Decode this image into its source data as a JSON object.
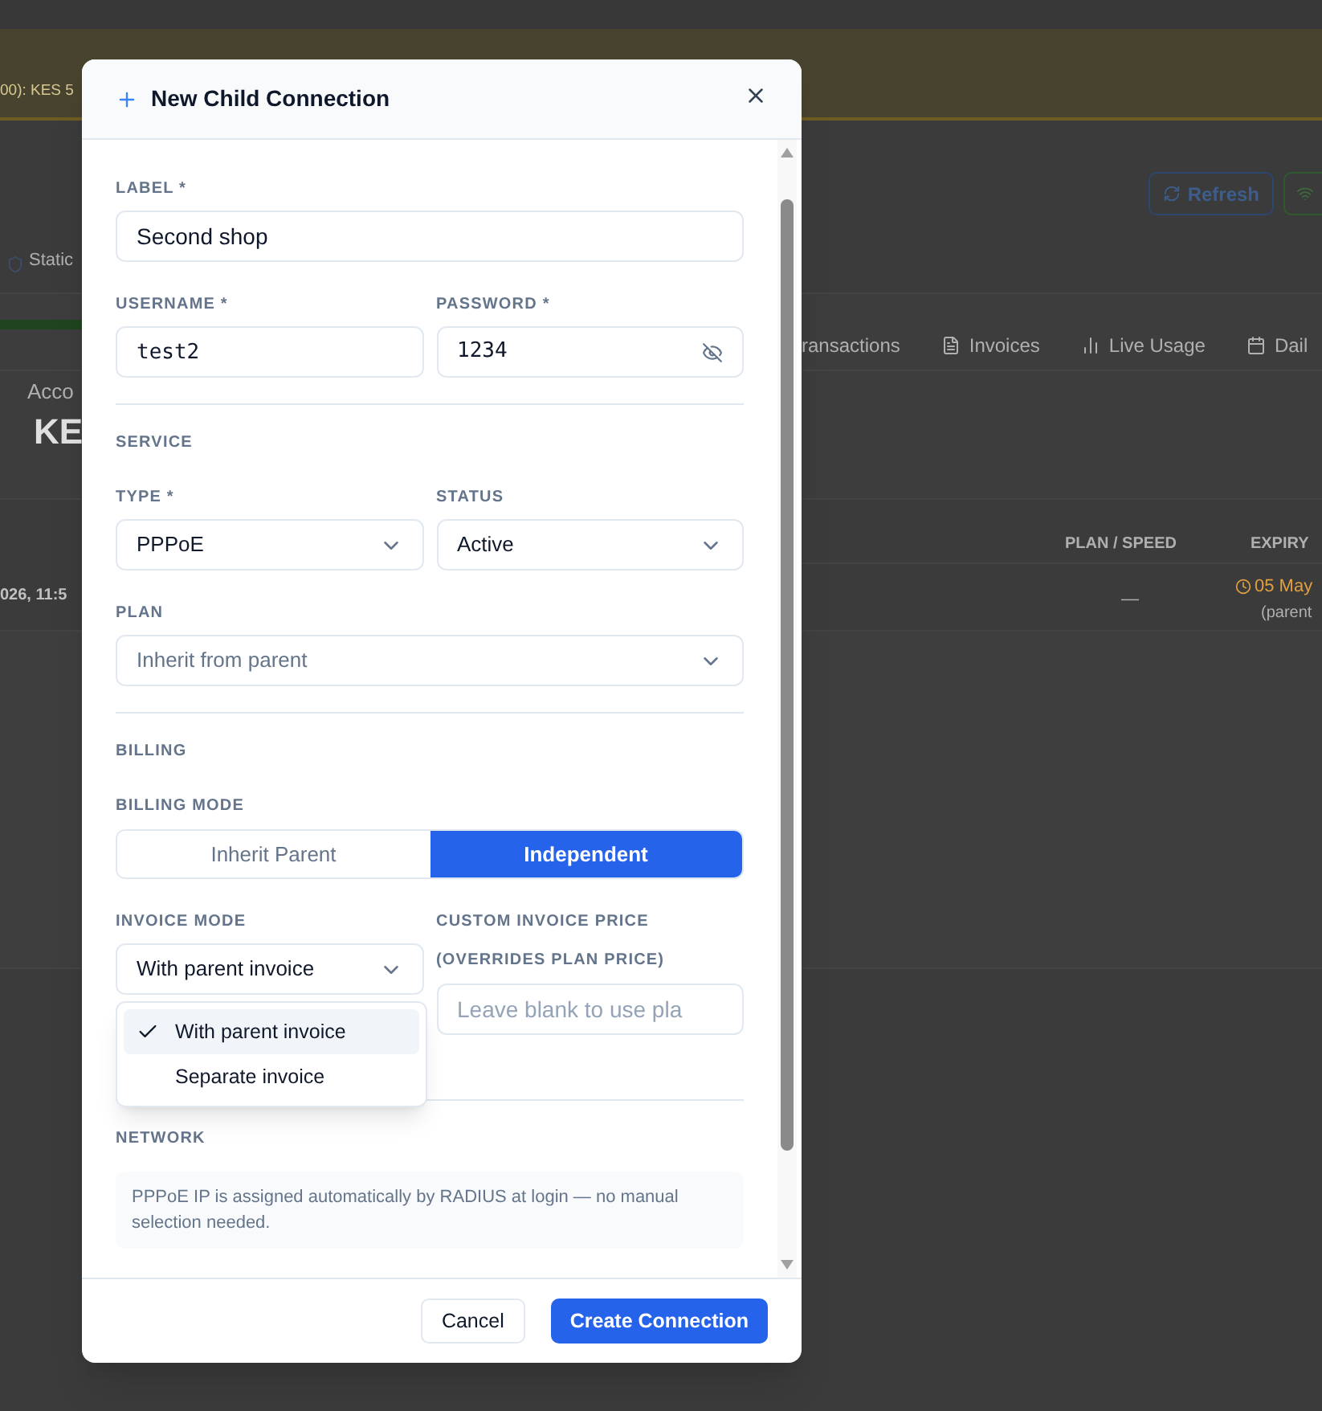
{
  "background": {
    "banner": "00): KES 5",
    "chip": "Static",
    "refresh_button": "Refresh",
    "tabs": [
      {
        "label": "ransactions",
        "kind": "plain"
      },
      {
        "label": "Invoices",
        "kind": "file"
      },
      {
        "label": "Live Usage",
        "kind": "chart"
      },
      {
        "label": "Dail",
        "kind": "calendar"
      }
    ],
    "account_label": "Acco",
    "account_value": "KE",
    "table": {
      "columns": [
        "PLAN / SPEED",
        "EXPIRY"
      ],
      "row": {
        "date": "026, 11:5",
        "plan": "—",
        "expiry": "05 May",
        "expiry_note": "(parent"
      }
    }
  },
  "dialog": {
    "title": "New Child Connection",
    "label_field": {
      "label": "LABEL *",
      "value": "Second shop"
    },
    "username_field": {
      "label": "USERNAME *",
      "value": "test2"
    },
    "password_field": {
      "label": "PASSWORD *",
      "value": "1234"
    },
    "service": {
      "title": "SERVICE",
      "type": {
        "label": "TYPE *",
        "value": "PPPoE"
      },
      "status": {
        "label": "STATUS",
        "value": "Active"
      },
      "plan": {
        "label": "PLAN",
        "placeholder": "Inherit from parent"
      }
    },
    "billing": {
      "title": "BILLING",
      "mode_label": "BILLING MODE",
      "modes": [
        {
          "label": "Inherit Parent",
          "selected": false
        },
        {
          "label": "Independent",
          "selected": true
        }
      ],
      "invoice_mode": {
        "label": "INVOICE MODE",
        "value": "With parent invoice",
        "open": true,
        "options": [
          {
            "label": "With parent invoice",
            "selected": true
          },
          {
            "label": "Separate invoice",
            "selected": false
          }
        ]
      },
      "custom_price": {
        "label": "CUSTOM INVOICE PRICE",
        "sublabel": "(OVERRIDES PLAN PRICE)",
        "placeholder": "Leave blank to use pla"
      }
    },
    "network": {
      "title": "NETWORK",
      "note": "PPPoE IP is assigned automatically by RADIUS at login — no manual selection needed."
    },
    "buttons": [
      {
        "label": "Cancel",
        "kind": "secondary"
      },
      {
        "label": "Create Connection",
        "kind": "primary"
      }
    ]
  }
}
